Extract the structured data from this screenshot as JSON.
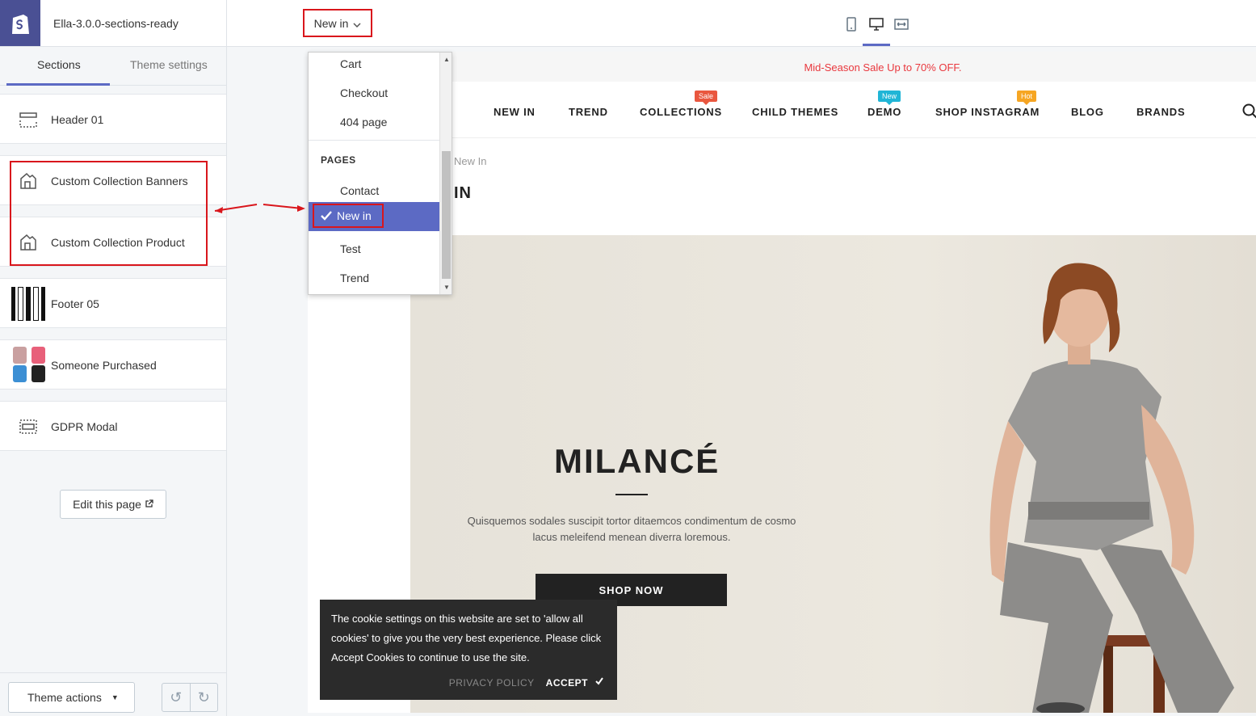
{
  "sidebar": {
    "theme_name": "Ella-3.0.0-sections-ready",
    "tabs": [
      {
        "label": "Sections",
        "active": true
      },
      {
        "label": "Theme settings",
        "active": false
      }
    ],
    "sections": [
      {
        "label": "Header 01",
        "icon": "header-layout-icon"
      },
      {
        "label": "Custom Collection Banners",
        "icon": "collection-icon"
      },
      {
        "label": "Custom Collection Product",
        "icon": "collection-icon"
      },
      {
        "label": "Footer 05",
        "icon": "footer-thumbnail"
      },
      {
        "label": "Someone Purchased",
        "icon": "product-thumbnail"
      },
      {
        "label": "GDPR Modal",
        "icon": "modal-layout-icon"
      }
    ],
    "edit_page_label": "Edit this page",
    "theme_actions_label": "Theme actions"
  },
  "topbar": {
    "page_select_value": "New in"
  },
  "dropdown": {
    "items_top": [
      "Cart",
      "Checkout",
      "404 page"
    ],
    "group_label": "PAGES",
    "items_pages": [
      "Contact",
      "New in",
      "Test",
      "Trend"
    ],
    "selected": "New in"
  },
  "store": {
    "announcement": "Mid-Season Sale Up to 70% OFF.",
    "menu": [
      {
        "label": "NEW IN",
        "badge": ""
      },
      {
        "label": "TREND",
        "badge": ""
      },
      {
        "label": "COLLECTIONS",
        "badge": "Sale"
      },
      {
        "label": "CHILD THEMES",
        "badge": ""
      },
      {
        "label": "DEMO",
        "badge": "New"
      },
      {
        "label": "SHOP INSTAGRAM",
        "badge": "Hot"
      },
      {
        "label": "BLOG",
        "badge": ""
      },
      {
        "label": "BRANDS",
        "badge": ""
      }
    ],
    "breadcrumb": "New In",
    "page_title": "IN",
    "hero": {
      "title": "MILANCÉ",
      "text": "Quisquemos sodales suscipit tortor ditaemcos condimentum de cosmo lacus meleifend menean diverra loremous.",
      "button": "SHOP NOW"
    },
    "cookie": {
      "text": "The cookie settings on this website are set to 'allow all cookies' to give you the very best experience. Please click Accept Cookies to continue to use the site.",
      "privacy_label": "PRIVACY POLICY",
      "accept_label": "ACCEPT"
    }
  },
  "colors": {
    "accent": "#5c6ac4",
    "highlight": "#d9161c",
    "badge_sale": "#e9573f",
    "badge_new": "#20b5d6",
    "badge_hot": "#f6a623"
  }
}
